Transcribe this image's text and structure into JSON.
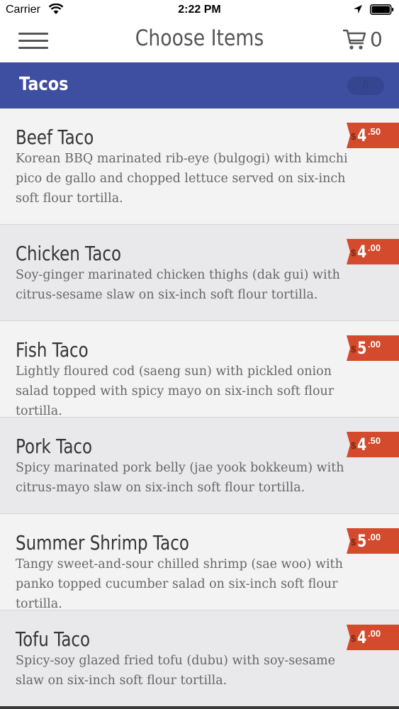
{
  "status_bar": {
    "carrier": "Carrier",
    "time": "2:22 PM"
  },
  "nav": {
    "title": "Choose Items",
    "cart_count": "0"
  },
  "category": {
    "title": "Tacos",
    "count": "6"
  },
  "colors": {
    "header": "#3e4ea1",
    "price_tag": "#d34a2c"
  },
  "items": [
    {
      "name": "Beef Taco",
      "description": "Korean BBQ marinated rib-eye (bulgogi) with kimchi pico de gallo and chopped lettuce served on six-inch soft flour tortilla.",
      "currency": "$",
      "price_whole": "4",
      "price_cents": ".50"
    },
    {
      "name": "Chicken Taco",
      "description": "Soy-ginger marinated chicken thighs (dak gui) with citrus-sesame slaw on six-inch soft flour tortilla.",
      "currency": "$",
      "price_whole": "4",
      "price_cents": ".00"
    },
    {
      "name": "Fish Taco",
      "description": "Lightly floured cod (saeng sun) with pickled onion salad topped with spicy mayo on six-inch soft flour tortilla.",
      "currency": "$",
      "price_whole": "5",
      "price_cents": ".00"
    },
    {
      "name": "Pork Taco",
      "description": "Spicy marinated pork belly (jae yook bokkeum) with citrus-mayo slaw on six-inch soft flour tortilla.",
      "currency": "$",
      "price_whole": "4",
      "price_cents": ".50"
    },
    {
      "name": "Summer Shrimp Taco",
      "description": "Tangy sweet-and-sour chilled shrimp (sae woo) with panko topped cucumber salad on six-inch soft flour tortilla.",
      "currency": "$",
      "price_whole": "5",
      "price_cents": ".00"
    },
    {
      "name": "Tofu Taco",
      "description": "Spicy-soy glazed fried tofu (dubu) with soy-sesame slaw on six-inch soft flour tortilla.",
      "currency": "$",
      "price_whole": "4",
      "price_cents": ".00"
    }
  ]
}
